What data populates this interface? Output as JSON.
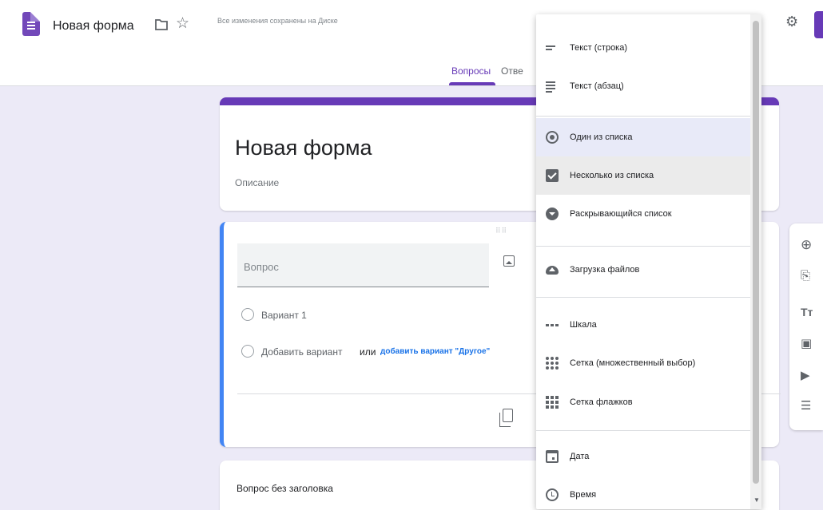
{
  "header": {
    "form_title": "Новая форма",
    "saved_status": "Все изменения сохранены на Диске",
    "tabs": [
      {
        "label": "Вопросы",
        "active": true
      },
      {
        "label": "Отве",
        "active": false
      }
    ],
    "accent_color": "#673ab7"
  },
  "title_card": {
    "title": "Новая форма",
    "description_placeholder": "Описание"
  },
  "question_card": {
    "question_placeholder": "Вопрос",
    "option_label": "Вариант 1",
    "add_option_label": "Добавить вариант",
    "or_label": "или",
    "add_other_link": "добавить вариант \"Другое\""
  },
  "second_card": {
    "title": "Вопрос без заголовка"
  },
  "question_type_menu": {
    "items": [
      {
        "label": "Текст (строка)",
        "icon": "short-text-icon"
      },
      {
        "label": "Текст (абзац)",
        "icon": "paragraph-icon"
      },
      {
        "label": "Один из списка",
        "icon": "radio-icon",
        "selected": true
      },
      {
        "label": "Несколько из списка",
        "icon": "checkbox-icon",
        "hovered": true
      },
      {
        "label": "Раскрывающийся список",
        "icon": "dropdown-icon"
      },
      {
        "label": "Загрузка файлов",
        "icon": "cloud-upload-icon"
      },
      {
        "label": "Шкала",
        "icon": "linear-scale-icon"
      },
      {
        "label": "Сетка (множественный выбор)",
        "icon": "grid-dots-icon"
      },
      {
        "label": "Сетка флажков",
        "icon": "grid-squares-icon"
      },
      {
        "label": "Дата",
        "icon": "calendar-icon"
      },
      {
        "label": "Время",
        "icon": "clock-icon"
      }
    ]
  },
  "side_toolbar": {
    "icons": [
      "add-question-icon",
      "import-questions-icon",
      "add-title-icon",
      "add-image-icon",
      "add-video-icon",
      "add-section-icon"
    ]
  }
}
